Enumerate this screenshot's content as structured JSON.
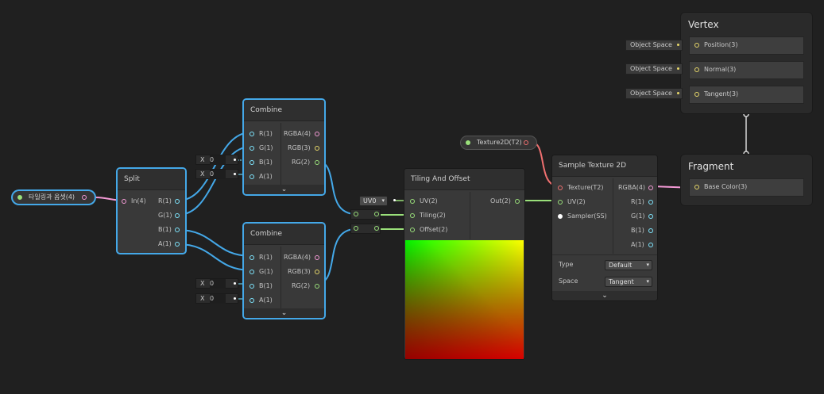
{
  "property": {
    "label": "타일링과 옵셋(4)"
  },
  "split": {
    "title": "Split",
    "input": "In(4)",
    "outputs": [
      "R(1)",
      "G(1)",
      "B(1)",
      "A(1)"
    ]
  },
  "combine_top": {
    "title": "Combine",
    "inputs": [
      "R(1)",
      "G(1)",
      "B(1)",
      "A(1)"
    ],
    "outputs": [
      "RGBA(4)",
      "RGB(3)",
      "RG(2)"
    ],
    "default_axis": "X",
    "default_b": "0",
    "default_a": "0"
  },
  "combine_bottom": {
    "title": "Combine",
    "inputs": [
      "R(1)",
      "G(1)",
      "B(1)",
      "A(1)"
    ],
    "outputs": [
      "RGBA(4)",
      "RGB(3)",
      "RG(2)"
    ],
    "default_axis": "X",
    "default_b": "0",
    "default_a": "0"
  },
  "tiling": {
    "title": "Tiling And Offset",
    "inputs": [
      "UV(2)",
      "Tiling(2)",
      "Offset(2)"
    ],
    "output": "Out(2)",
    "uv_default": "UV0"
  },
  "texture_property": {
    "label": "Texture2D(T2)"
  },
  "sample": {
    "title": "Sample Texture 2D",
    "inputs": [
      "Texture(T2)",
      "UV(2)",
      "Sampler(SS)"
    ],
    "outputs": [
      "RGBA(4)",
      "R(1)",
      "G(1)",
      "B(1)",
      "A(1)"
    ],
    "type_label": "Type",
    "type_value": "Default",
    "space_label": "Space",
    "space_value": "Tangent"
  },
  "vertex": {
    "title": "Vertex",
    "blocks": [
      "Position(3)",
      "Normal(3)",
      "Tangent(3)"
    ],
    "space_label": "Object Space"
  },
  "fragment": {
    "title": "Fragment",
    "blocks": [
      "Base Color(3)"
    ]
  },
  "icons": {
    "collapse": "chevron-down-icon",
    "dropdown": "triangle-down-icon"
  },
  "colors": {
    "selection": "#44a8e8",
    "float_port": "#7ee6ff",
    "vector4_port": "#f49ad6",
    "vector2_port": "#9ae07a",
    "texture_port": "#f07070",
    "background": "#202020"
  }
}
